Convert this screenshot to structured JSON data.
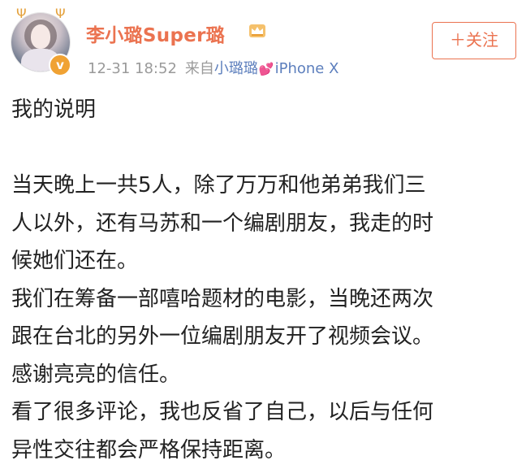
{
  "user": {
    "name": "李小璐Super璐",
    "verified_mark": "v",
    "crown_icon": "crown-icon",
    "avatar_icon": "avatar"
  },
  "meta": {
    "time": "12-31 18:52",
    "from_label": "来自",
    "source_name": "小璐璐",
    "heart": "💕",
    "device": "iPhone X"
  },
  "follow_button": {
    "label": "＋关注"
  },
  "post": {
    "title": "我的说明",
    "lines": [
      "当天晚上一共5人，除了万万和他弟弟我们三",
      "人以外，还有马苏和一个编剧朋友，我走的时",
      "候她们还在。",
      "我们在筹备一部嘻哈题材的电影，当晚还两次",
      "跟在台北的另外一位编剧朋友开了视频会议。",
      "感谢亮亮的信任。",
      "看了很多评论，我也反省了自己，以后与任何",
      "异性交往都会严格保持距离。"
    ]
  },
  "colors": {
    "accent": "#eb7350",
    "link": "#5d7fbd",
    "meta": "#9a9a9a",
    "badge": "#f0a233"
  }
}
